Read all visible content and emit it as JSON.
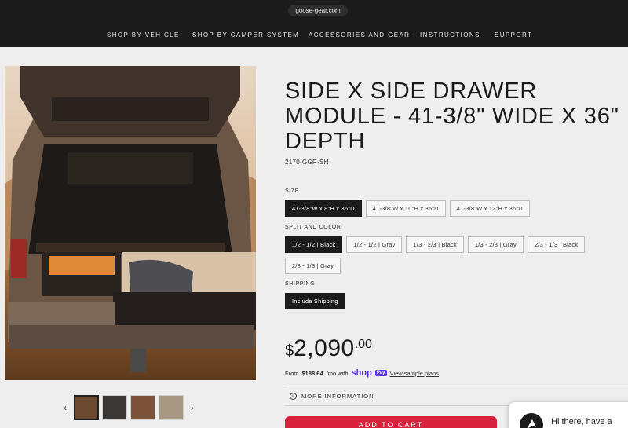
{
  "browser": {
    "url": "goose-gear.com"
  },
  "nav": {
    "items": [
      {
        "label": "SHOP BY VEHICLE"
      },
      {
        "label": "SHOP BY CAMPER SYSTEM"
      },
      {
        "label": "ACCESSORIES AND GEAR"
      },
      {
        "label": "INSTRUCTIONS"
      },
      {
        "label": "SUPPORT"
      }
    ]
  },
  "product": {
    "title": "SIDE X SIDE DRAWER MODULE - 41-3/8\" WIDE X 36\" DEPTH",
    "sku": "2170-GGR-SH",
    "size": {
      "label": "SIZE",
      "options": [
        "41-3/8\"W x 8\"H x 36\"D",
        "41-3/8\"W x 10\"H x 36\"D",
        "41-3/8\"W x 12\"H x 36\"D"
      ],
      "selected": 0
    },
    "split": {
      "label": "SPLIT AND COLOR",
      "options": [
        "1/2 - 1/2 | Black",
        "1/2 - 1/2 | Gray",
        "1/3 - 2/3 | Black",
        "1/3 - 2/3 | Gray",
        "2/3 - 1/3 | Black",
        "2/3 - 1/3 | Gray"
      ],
      "selected": 0
    },
    "shipping": {
      "label": "SHIPPING",
      "options": [
        "Include Shipping"
      ],
      "selected": 0
    },
    "price": {
      "currency": "$",
      "main": "2,090",
      "cents": ".00"
    },
    "finance": {
      "prefix": "From ",
      "amount": "$188.64",
      "suffix": "/mo with",
      "brand": "shop",
      "pay": "Pay",
      "link": "View sample plans"
    },
    "more_info": "MORE INFORMATION",
    "add_to_cart": "ADD TO CART"
  },
  "gallery": {
    "thumbnail_count": 4,
    "active": 0
  },
  "chat": {
    "text": "Hi there, have a"
  },
  "colors": {
    "accent": "#d8213c",
    "header": "#1b1b1b",
    "shop_pay": "#5a31f4"
  }
}
